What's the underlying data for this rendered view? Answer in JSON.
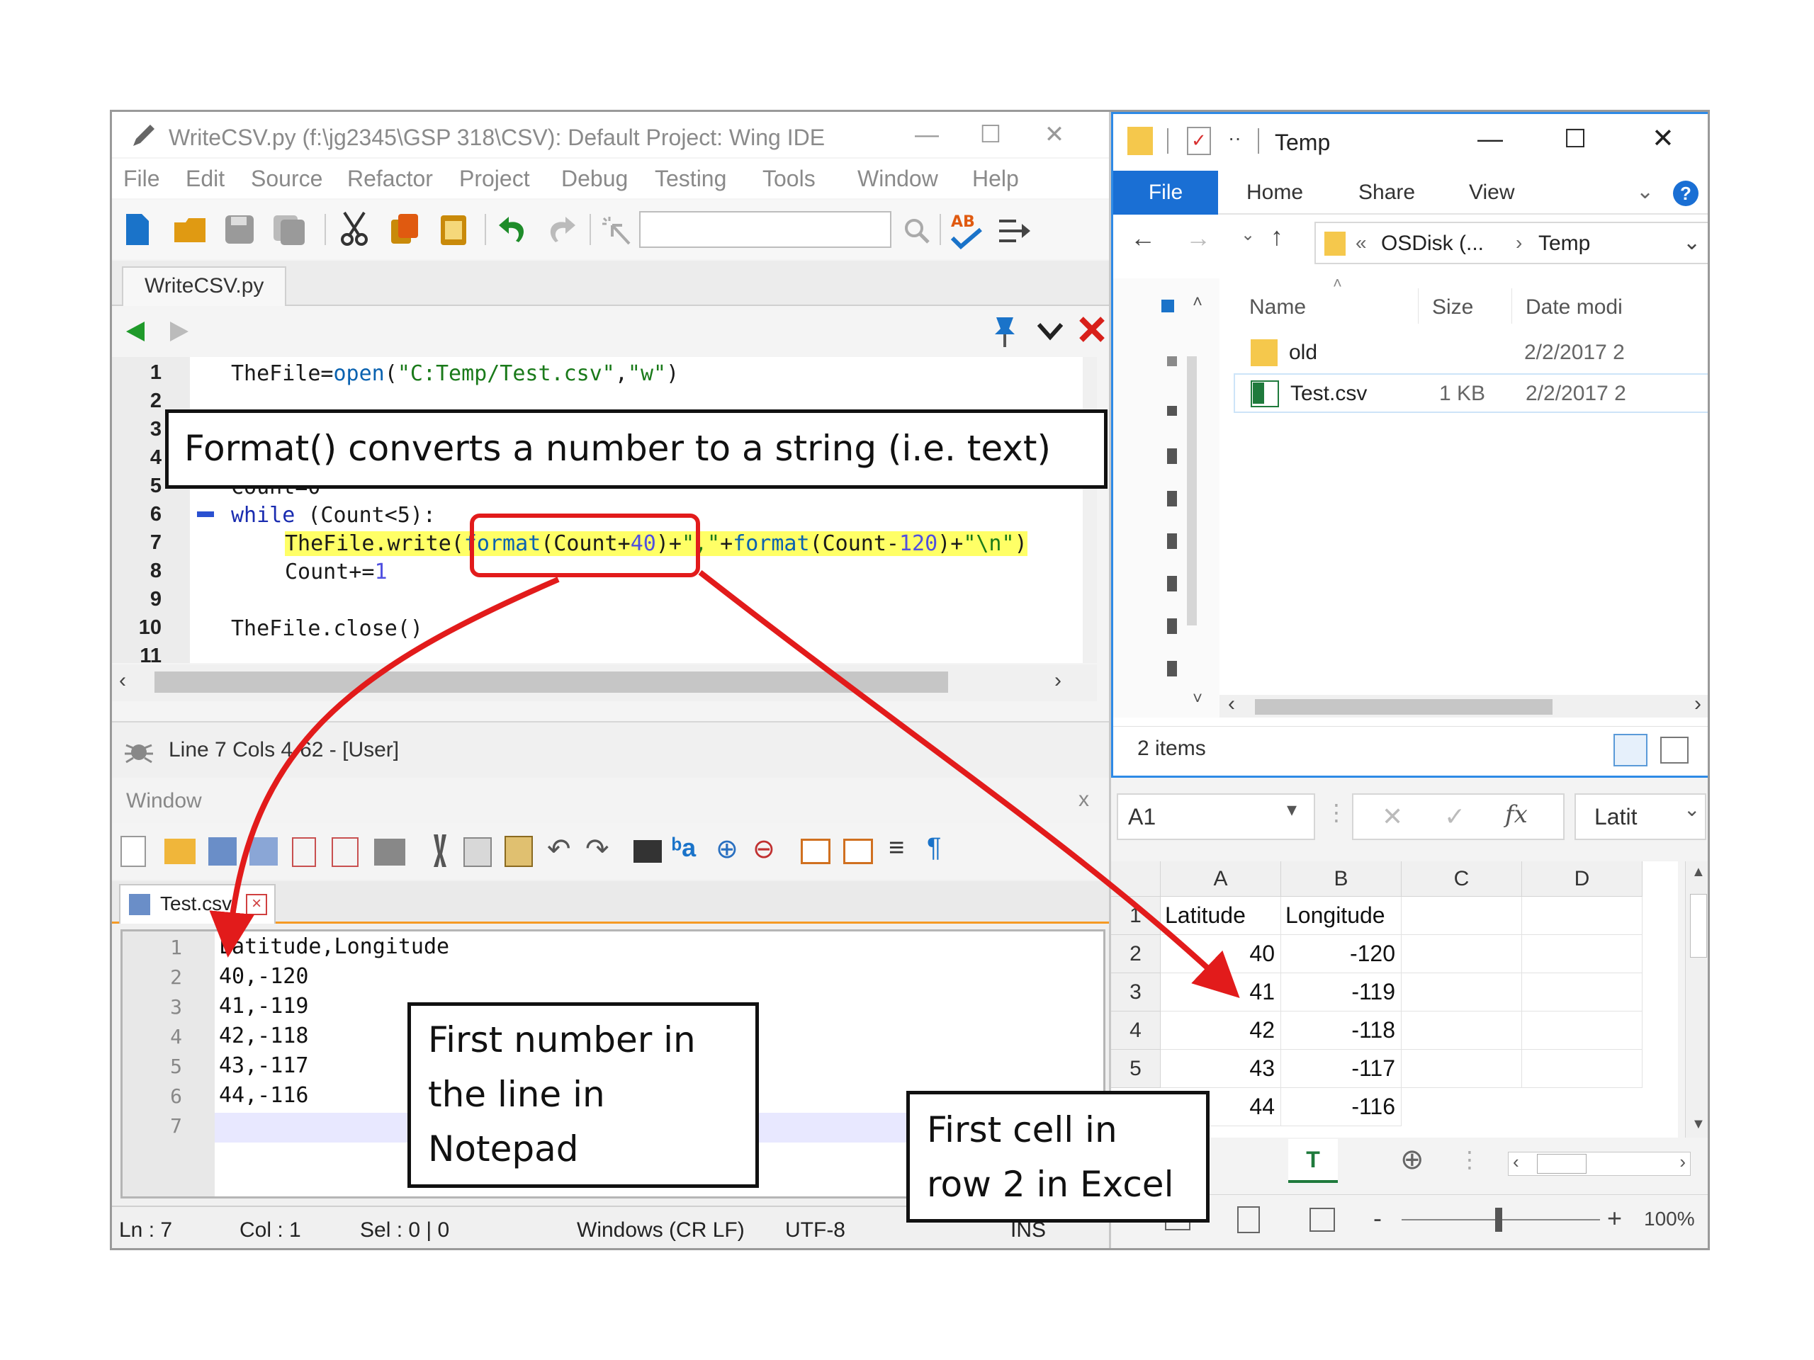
{
  "wing": {
    "title": "WriteCSV.py (f:\\jg2345\\GSP 318\\CSV): Default Project: Wing IDE",
    "menu": [
      "File",
      "Edit",
      "Source",
      "Refactor",
      "Project",
      "Debug",
      "Testing",
      "Tools",
      "Window",
      "Help"
    ],
    "tab": "WriteCSV.py",
    "line_numbers": [
      "1",
      "2",
      "3",
      "4",
      "5",
      "6",
      "7",
      "8",
      "9",
      "10",
      "11"
    ],
    "code": {
      "l1_a": "TheFile=",
      "l1_fn": "open",
      "l1_b": "(",
      "l1_s1": "\"C:Temp/Test.csv\"",
      "l1_c": ",",
      "l1_s2": "\"w\"",
      "l1_d": ")",
      "l5": "Count=0",
      "l6_kw": "while",
      "l6_rest": " (Count<5):",
      "l7_a": "TheFile.write(",
      "l7_fn1": "format",
      "l7_b": "(Count+",
      "l7_n1": "40",
      "l7_c": ")+",
      "l7_s1": "\",\"",
      "l7_d": "+",
      "l7_fn2": "format",
      "l7_e": "(Count-",
      "l7_n2": "120",
      "l7_f": ")+",
      "l7_s2": "\"\\n\"",
      "l7_g": ")",
      "l8_a": "Count+=",
      "l8_n": "1",
      "l10": "TheFile.close()"
    },
    "status": "Line 7 Cols 4-62 - [User]"
  },
  "explorer": {
    "title": "Temp",
    "ribbon_tabs": [
      "File",
      "Home",
      "Share",
      "View"
    ],
    "address_prefix": "«",
    "address_parts": [
      "OSDisk (...",
      "Temp"
    ],
    "columns": [
      "Name",
      "Size",
      "Date modi"
    ],
    "files": [
      {
        "name": "old",
        "size": "",
        "date": "2/2/2017 2"
      },
      {
        "name": "Test.csv",
        "size": "1 KB",
        "date": "2/2/2017 2"
      }
    ],
    "item_count": "2 items"
  },
  "notepad": {
    "menu": "Window",
    "tab": "Test.csv",
    "line_numbers": [
      "1",
      "2",
      "3",
      "4",
      "5",
      "6",
      "7"
    ],
    "lines": [
      "Latitude,Longitude",
      "40,-120",
      "41,-119",
      "42,-118",
      "43,-117",
      "44,-116",
      ""
    ],
    "status": {
      "ln": "Ln : 7",
      "col": "Col : 1",
      "sel": "Sel : 0 | 0",
      "eol": "Windows (CR LF)",
      "enc": "UTF-8",
      "mode": "INS"
    }
  },
  "excel": {
    "name_box": "A1",
    "formula_value": "Latit",
    "col_headers": [
      "A",
      "B",
      "C",
      "D"
    ],
    "row_headers": [
      "1",
      "2",
      "3",
      "4",
      "5"
    ],
    "header_row": [
      "Latitude",
      "Longitude"
    ],
    "rows": [
      [
        "40",
        "-120"
      ],
      [
        "41",
        "-119"
      ],
      [
        "42",
        "-118"
      ],
      [
        "43",
        "-117"
      ],
      [
        "44",
        "-116"
      ]
    ],
    "sheet_tab": "T",
    "zoom": "100%"
  },
  "callouts": {
    "format": "Format() converts a number to a string (i.e. text)",
    "notepad": [
      "First number in",
      "the line in",
      "Notepad"
    ],
    "excel": [
      "First cell in",
      "row 2 in Excel"
    ]
  },
  "colors": {
    "highlight": "#ffff66",
    "annotation_red": "#e21b1b",
    "explorer_blue": "#1a6fd4"
  }
}
